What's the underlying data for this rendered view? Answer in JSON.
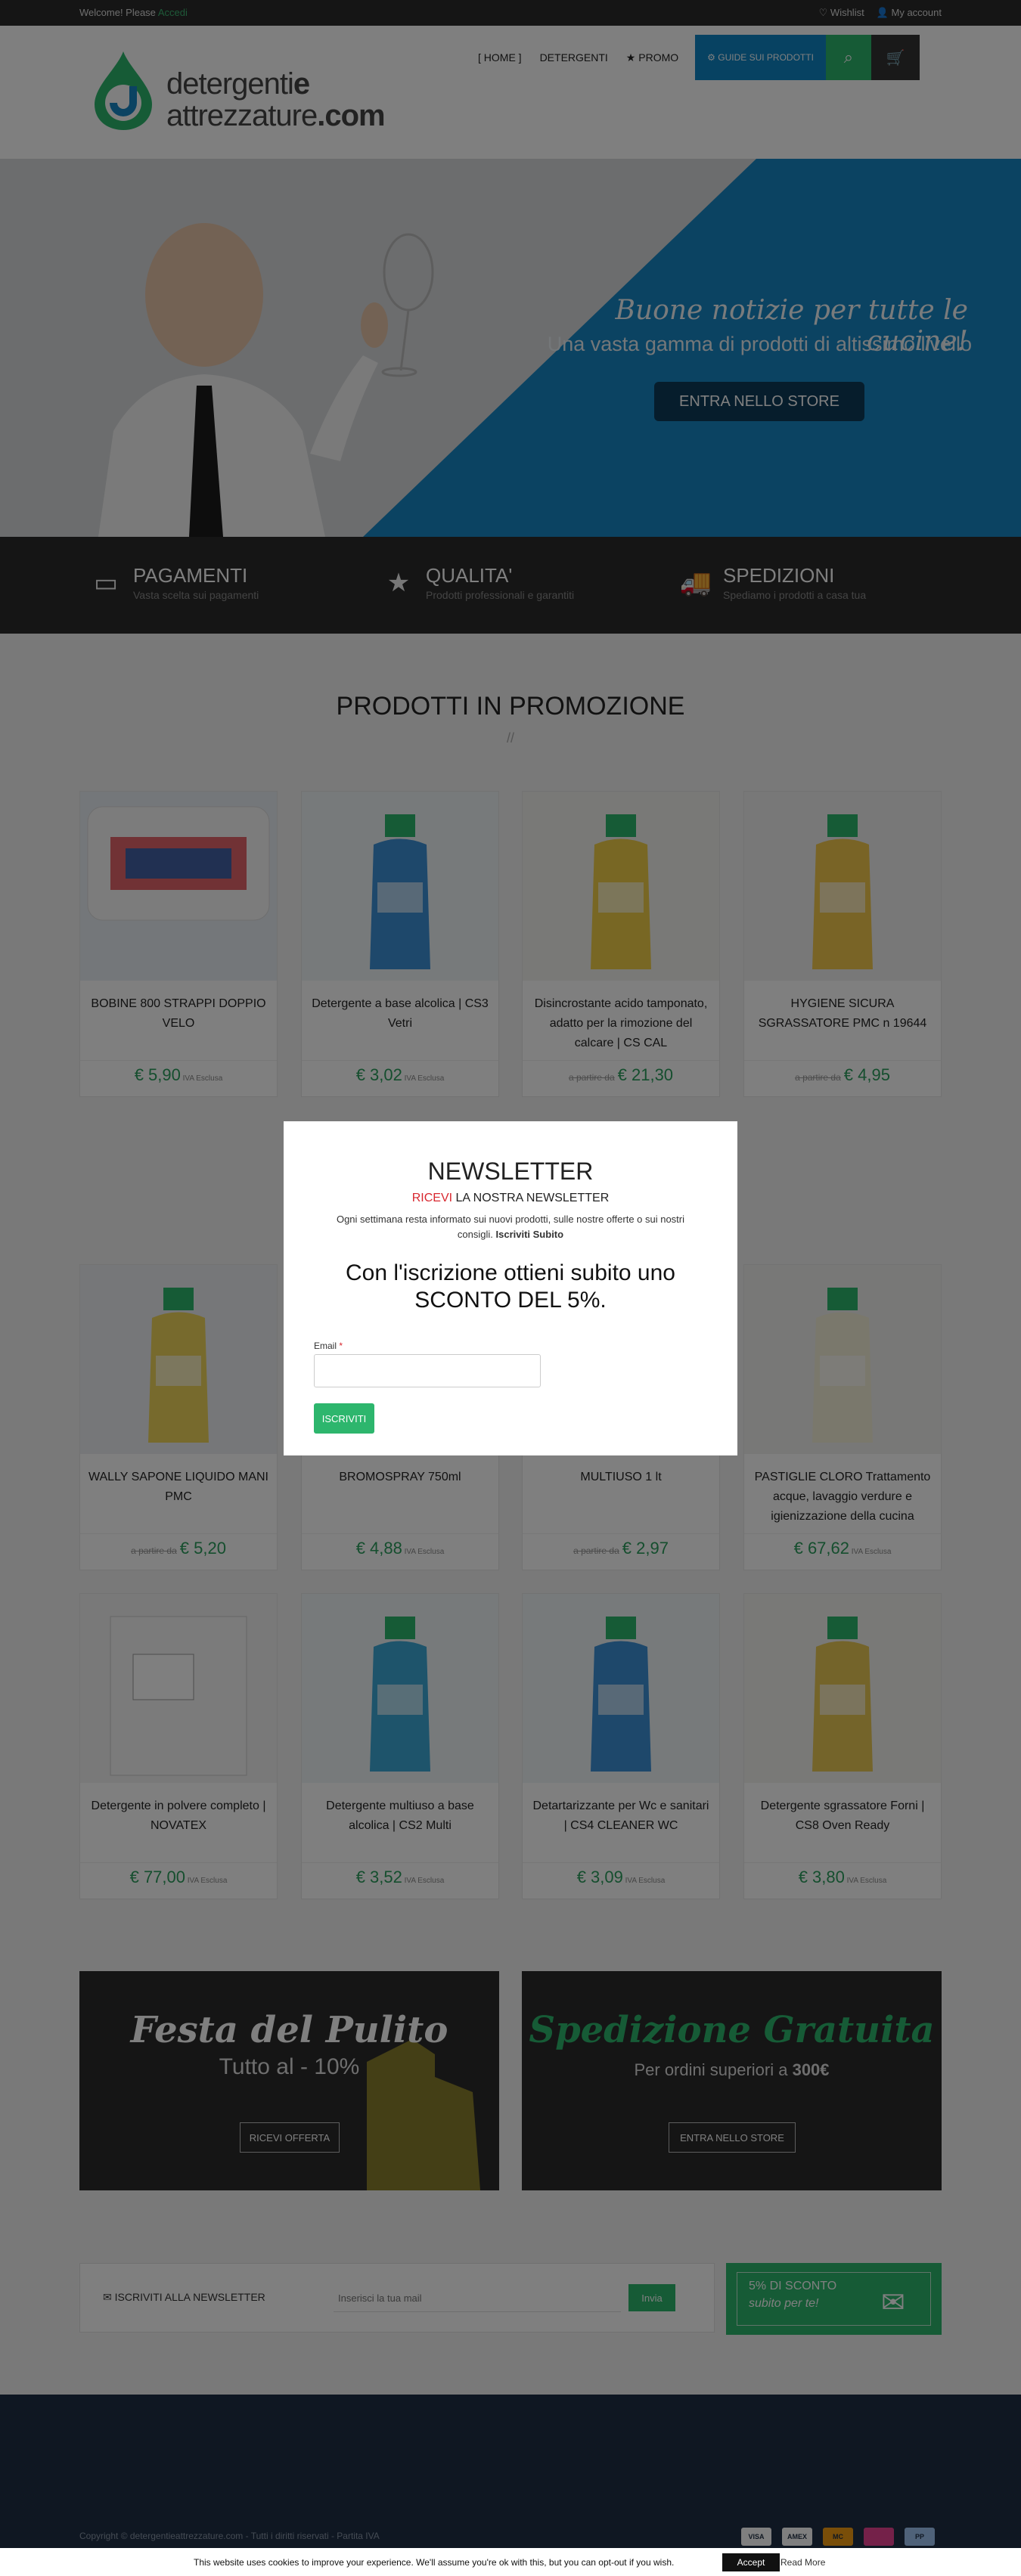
{
  "topbar": {
    "welcome": "Welcome! Please",
    "login": "Accedi",
    "wishlist": "Wishlist",
    "account": "My account"
  },
  "logo": {
    "line1": "detergenti",
    "line1b": "e",
    "line2": "attrezzature",
    "line2b": ".com"
  },
  "nav": {
    "home": "HOME",
    "detergenti": "DETERGENTI",
    "promo": "PROMO",
    "quick": "GUIDE SUI PRODOTTI"
  },
  "hero": {
    "title": "Buone notizie per tutte le cucine!",
    "subtitle": "Una vasta gamma di prodotti di altissimo livello",
    "cta": "ENTRA NELLO STORE"
  },
  "features": [
    {
      "title": "PAGAMENTI",
      "subtitle": "Vasta scelta sui pagamenti",
      "icon": "credit-card-icon"
    },
    {
      "title": "QUALITA'",
      "subtitle": "Prodotti professionali e garantiti",
      "icon": "star-icon"
    },
    {
      "title": "SPEDIZIONI",
      "subtitle": "Spediamo i prodotti a casa tua",
      "icon": "truck-icon"
    }
  ],
  "section_title": "PRODOTTI IN PROMOZIONE",
  "products": [
    {
      "name": "BOBINE 800 STRAPPI DOPPIO VELO",
      "old": "",
      "price": "€ 5,90",
      "tax": "IVA Esclusa"
    },
    {
      "name": "Detergente a base alcolica | CS3 Vetri",
      "old": "",
      "price": "€ 3,02",
      "tax": "IVA Esclusa"
    },
    {
      "name": "Disincrostante acido tamponato, adatto per la rimozione del calcare | CS CAL",
      "old": "a partire da",
      "price": "€ 21,30",
      "tax": ""
    },
    {
      "name": "HYGIENE SICURA SGRASSATORE PMC n 19644",
      "old": "a partire da",
      "price": "€ 4,95",
      "tax": ""
    },
    {
      "name": "WALLY SAPONE LIQUIDO MANI PMC",
      "old": "a partire da",
      "price": "€ 5,20",
      "tax": ""
    },
    {
      "name": "BROMOSPRAY 750ml",
      "old": "",
      "price": "€ 4,88",
      "tax": "IVA Esclusa"
    },
    {
      "name": "MULTIUSO 1 lt",
      "old": "a partire da",
      "price": "€ 2,97",
      "tax": ""
    },
    {
      "name": "PASTIGLIE CLORO Trattamento acque, lavaggio verdure e igienizzazione della cucina",
      "old": "",
      "price": "€ 67,62",
      "tax": "IVA Esclusa"
    },
    {
      "name": "Detergente in polvere completo | NOVATEX",
      "old": "",
      "price": "€ 77,00",
      "tax": "IVA Esclusa"
    },
    {
      "name": "Detergente multiuso a base alcolica | CS2 Multi",
      "old": "",
      "price": "€ 3,52",
      "tax": "IVA Esclusa"
    },
    {
      "name": "Detartarizzante per Wc e sanitari | CS4 CLEANER WC",
      "old": "",
      "price": "€ 3,09",
      "tax": "IVA Esclusa"
    },
    {
      "name": "Detergente sgrassatore Forni | CS8 Oven Ready",
      "old": "",
      "price": "€ 3,80",
      "tax": "IVA Esclusa"
    }
  ],
  "banners": [
    {
      "title": "Festa del Pulito",
      "subtitle": "Tutto al - 10%",
      "button": "RICEVI OFFERTA",
      "title_color": "#ffffff"
    },
    {
      "title": "Spedizione Gratuita",
      "subtitle_pre": "Per ordini superiori a",
      "subtitle_strong": "300€",
      "button": "ENTRA NELLO STORE",
      "title_color": "#2db66d"
    }
  ],
  "newsletter_bar": {
    "label": "ISCRIVITI ALLA NEWSLETTER",
    "placeholder": "Inserisci la tua mail",
    "button": "Invia"
  },
  "sconto": {
    "line1": "5% DI SCONTO",
    "line2": "subito per te!"
  },
  "footer": {
    "copyright": "Copyright © detergentieattrezzature.com - Tutti i diritti riservati - Partita IVA"
  },
  "payments": [
    "VISA",
    "AMEX",
    "MC",
    "",
    "PP"
  ],
  "modal": {
    "title": "NEWSLETTER",
    "sub_red": "RICEVI",
    "sub_rest": "LA NOSTRA NEWSLETTER",
    "desc": "Ogni settimana resta informato sui nuovi prodotti, sulle nostre offerte o sui nostri consigli.",
    "desc_bold": "Iscriviti Subito",
    "big": "Con l'iscrizione ottieni subito uno SCONTO DEL 5%.",
    "email_label": "Email",
    "button": "ISCRIVITI"
  },
  "cookie": {
    "text": "This website uses cookies to improve your experience. We'll assume you're ok with this, but you can opt-out if you wish.",
    "accept": "Accept",
    "read_more": "Read More"
  },
  "colors": {
    "green": "#2db66d",
    "blue": "#1787c4",
    "dark": "#2b2b2b",
    "price": "#2a9d5c",
    "red": "#d8272f"
  }
}
